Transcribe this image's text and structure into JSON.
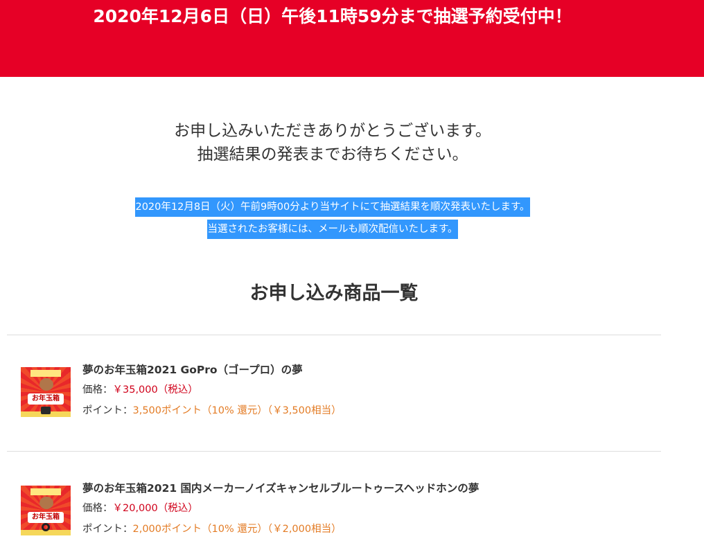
{
  "banner": {
    "text": "2020年12月6日（日）午後11時59分まで抽選予約受付中！"
  },
  "thanks": {
    "line1": "お申し込みいただきありがとうございます。",
    "line2": "抽選結果の発表までお待ちください。"
  },
  "notice": {
    "line1": "2020年12月8日（火）午前9時00分より当サイトにて抽選結果を順次発表いたします。",
    "line2": "当選されたお客様には、メールも順次配信いたします。"
  },
  "section": {
    "title": "お申し込み商品一覧"
  },
  "products": [
    {
      "name": "夢のお年玉箱2021 GoPro（ゴープロ）の夢",
      "price_label": "価格：",
      "price_value": "￥35,000（税込）",
      "points_label": "ポイント：",
      "points_value": "3,500ポイント（10% 還元）（￥3,500相当）",
      "thumb_text": "お年玉箱"
    },
    {
      "name": "夢のお年玉箱2021 国内メーカーノイズキャンセルブルートゥースヘッドホンの夢",
      "price_label": "価格：",
      "price_value": "￥20,000（税込）",
      "points_label": "ポイント：",
      "points_value": "2,000ポイント（10% 還元）（￥2,000相当）",
      "thumb_text": "お年玉箱"
    }
  ],
  "colors": {
    "banner_bg": "#e60026",
    "highlight": "#3297fd",
    "price": "#d0021b",
    "points": "#e37b24"
  }
}
